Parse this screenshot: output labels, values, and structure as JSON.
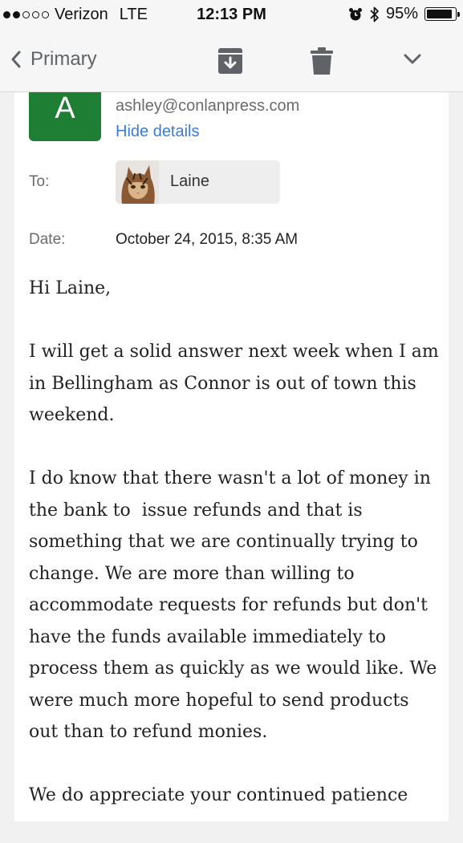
{
  "status_bar": {
    "carrier": "Verizon",
    "network": "LTE",
    "time": "12:13 PM",
    "battery_text": "95%",
    "battery_level": 0.95,
    "signal_bars_filled": 2,
    "signal_bars_total": 5
  },
  "nav": {
    "back_label": "Primary",
    "icons": [
      "chevron-left-icon",
      "archive-icon",
      "trash-icon",
      "chevron-down-icon"
    ]
  },
  "message": {
    "sender_initial": "A",
    "sender_color": "#1e7e34",
    "sender_email": "ashley@conlanpress.com",
    "hide_details": "Hide details",
    "to_label": "To:",
    "recipient_name": "Laine",
    "date_label": "Date:",
    "date_value": "October 24, 2015, 8:35 AM",
    "paragraphs": [
      "Hi Laine,",
      "I will get a solid answer next week when I am in Bellingham as Connor is out of town this weekend.",
      "I do know that there wasn't a lot of money in the bank to  issue refunds and that is something that we are continually trying to change. We are more than willing to accommodate requests for refunds but don't have the funds available immediately to process them as quickly as we would like. We were much more hopeful to send products out than to refund monies.",
      "We do appreciate your continued patience"
    ]
  },
  "colors": {
    "link": "#3a7bd5",
    "nav_icon": "#5f6368"
  }
}
